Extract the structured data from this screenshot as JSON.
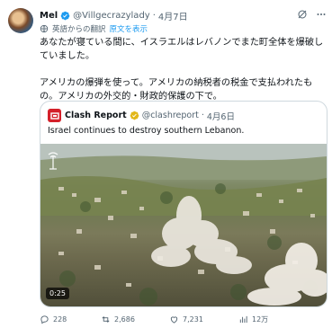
{
  "tweet": {
    "author_name": "Mel",
    "handle": "@Villgecrazylady",
    "separator": "·",
    "date": "4月7日",
    "translation_note": "英語からの翻訳",
    "show_original": "原文を表示",
    "body_p1": "あなたが寝ている間に、イスラエルはレバノンでまた町全体を爆破していました。",
    "body_p2": "アメリカの爆弾を使って。アメリカの納税者の税金で支払われたもの。アメリカの外交的・財政的保護の下で。"
  },
  "quote": {
    "author_name": "Clash Report",
    "handle": "@clashreport",
    "separator": "·",
    "date": "4月6日",
    "text": "Israel continues to destroy southern Lebanon.",
    "video_time": "0:25"
  },
  "actions": {
    "replies": "228",
    "reposts": "2,686",
    "likes": "7,231",
    "views": "12万"
  },
  "colors": {
    "accent": "#1d9bf0",
    "secondary_text": "#536471",
    "border": "#cfd9de",
    "verified_blue": "#1d9bf0",
    "verified_gold": "#e2b719",
    "clash_red": "#d4202a"
  },
  "icons": [
    "verified-badge-icon",
    "grok-icon",
    "more-icon",
    "globe-icon",
    "reply-icon",
    "repost-icon",
    "like-icon",
    "views-icon",
    "watermark-icon"
  ]
}
